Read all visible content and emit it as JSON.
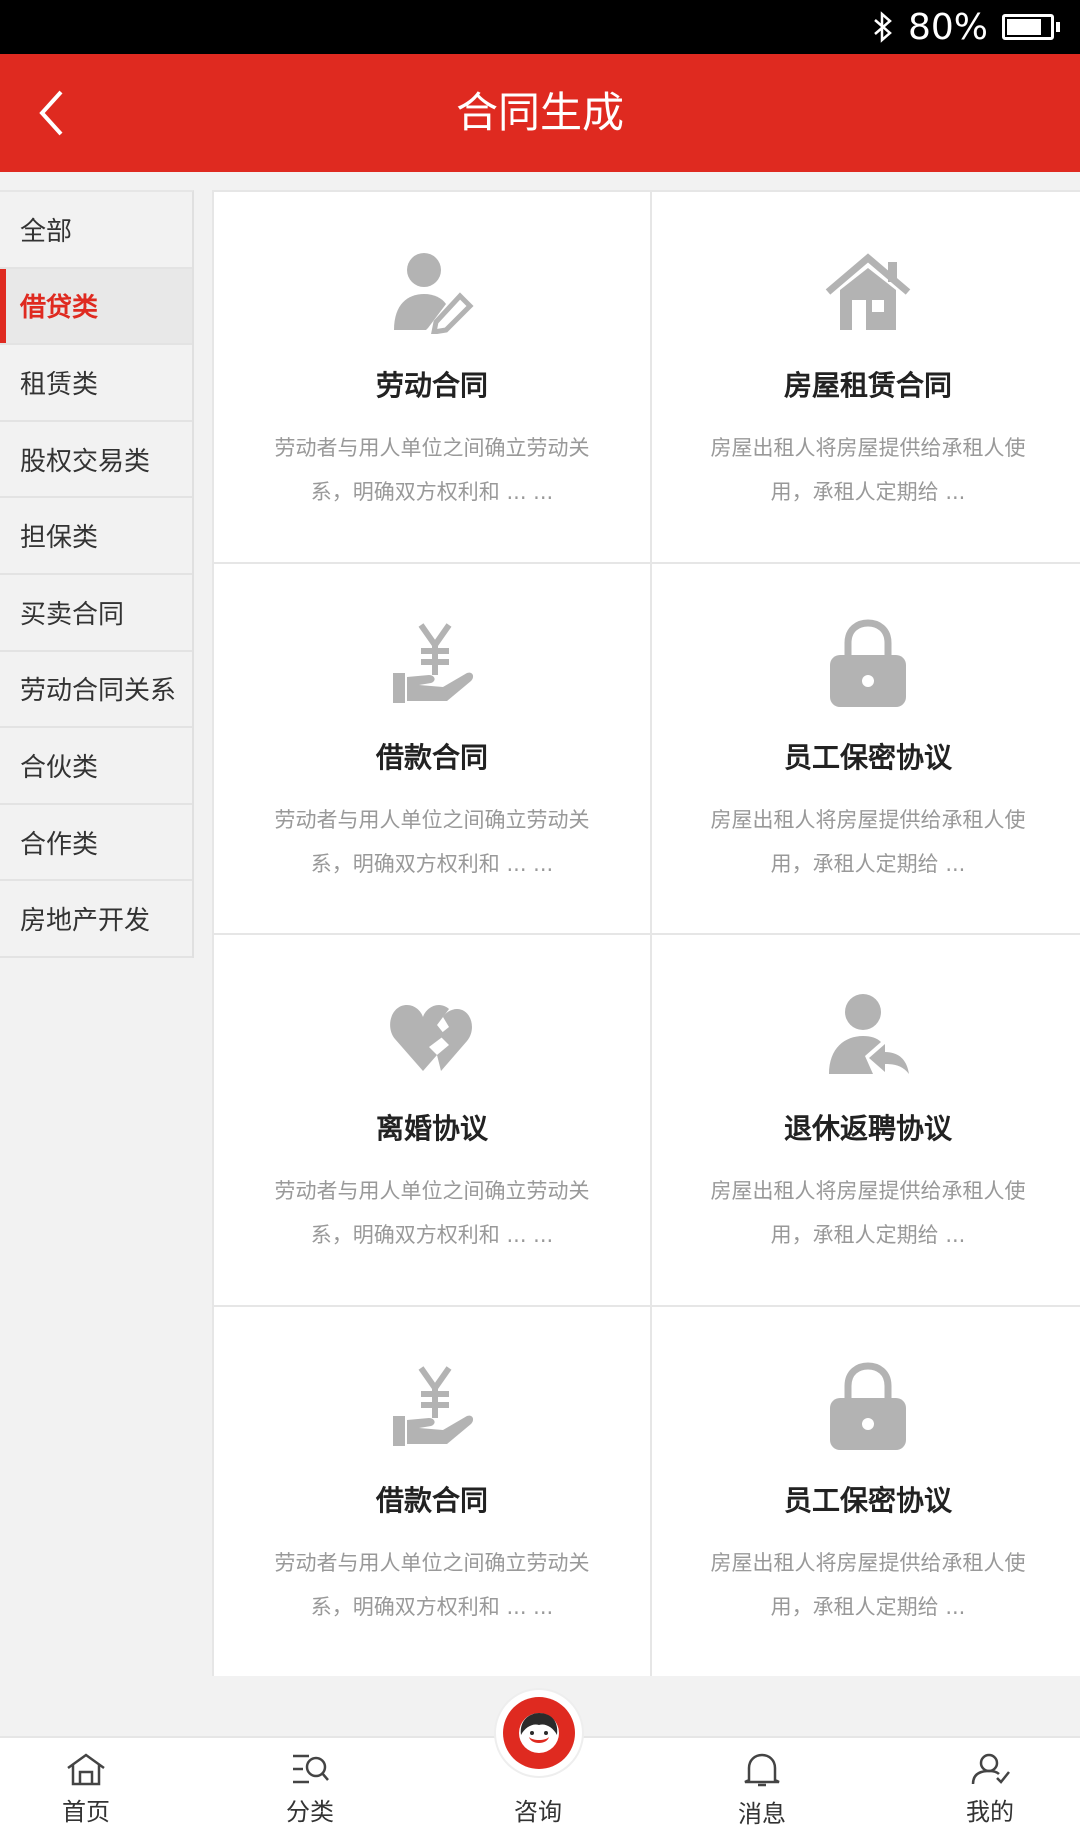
{
  "status_bar": {
    "battery_percent": "80%",
    "battery_level": 0.8
  },
  "header": {
    "title": "合同生成",
    "back_icon": "chevron-left-icon"
  },
  "sidebar": {
    "active_index": 1,
    "items": [
      {
        "label": "全部"
      },
      {
        "label": "借贷类"
      },
      {
        "label": "租赁类"
      },
      {
        "label": "股权交易类"
      },
      {
        "label": "担保类"
      },
      {
        "label": "买卖合同"
      },
      {
        "label": "劳动合同关系"
      },
      {
        "label": "合伙类"
      },
      {
        "label": "合作类"
      },
      {
        "label": "房地产开发"
      }
    ]
  },
  "cards": [
    {
      "icon": "user-edit-icon",
      "title": "劳动合同",
      "desc": "劳动者与用人单位之间确立劳动关系，明确双方权利和 ... ..."
    },
    {
      "icon": "house-icon",
      "title": "房屋租赁合同",
      "desc": "房屋出租人将房屋提供给承租人使用，承租人定期给 ..."
    },
    {
      "icon": "yen-hand-icon",
      "title": "借款合同",
      "desc": "劳动者与用人单位之间确立劳动关系，明确双方权利和 ... ..."
    },
    {
      "icon": "lock-icon",
      "title": "员工保密协议",
      "desc": "房屋出租人将房屋提供给承租人使用，承租人定期给 ..."
    },
    {
      "icon": "broken-hearts-icon",
      "title": "离婚协议",
      "desc": "劳动者与用人单位之间确立劳动关系，明确双方权利和 ... ..."
    },
    {
      "icon": "user-return-icon",
      "title": "退休返聘协议",
      "desc": "房屋出租人将房屋提供给承租人使用，承租人定期给 ..."
    },
    {
      "icon": "yen-hand-icon",
      "title": "借款合同",
      "desc": "劳动者与用人单位之间确立劳动关系，明确双方权利和 ... ..."
    },
    {
      "icon": "lock-icon",
      "title": "员工保密协议",
      "desc": "房屋出租人将房屋提供给承租人使用，承租人定期给 ..."
    }
  ],
  "tabbar": {
    "items": [
      {
        "label": "首页",
        "icon": "home-icon"
      },
      {
        "label": "分类",
        "icon": "category-search-icon"
      },
      {
        "label": "咨询",
        "icon": "consultant-avatar-icon"
      },
      {
        "label": "消息",
        "icon": "bell-icon"
      },
      {
        "label": "我的",
        "icon": "user-profile-icon"
      }
    ]
  },
  "colors": {
    "brand_red": "#df2a20",
    "icon_gray": "#b3b3b3",
    "text_dark": "#222222",
    "text_gray": "#999999"
  }
}
